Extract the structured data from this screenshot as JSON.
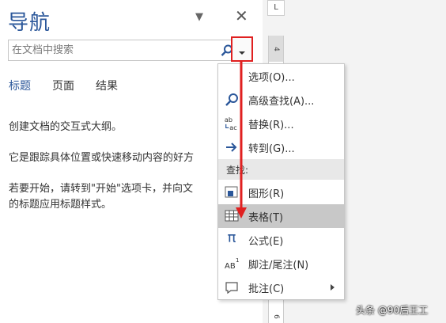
{
  "nav": {
    "title": "导航",
    "search_placeholder": "在文档中搜索",
    "tabs": [
      "标题",
      "页面",
      "结果"
    ],
    "description_lines": [
      "创建文档的交互式大纲。",
      "它是跟踪具体位置或快速移动内容的好方",
      "若要开始，请转到\"开始\"选项卡，并向文",
      "的标题应用标题样式。"
    ]
  },
  "ruler": {
    "top_letter": "L",
    "numbers": [
      "4",
      "6"
    ]
  },
  "menu": {
    "items": [
      {
        "label": "选项(O)...",
        "icon": "none"
      },
      {
        "label": "高级查找(A)...",
        "icon": "search-icon"
      },
      {
        "label": "替换(R)...",
        "icon": "replace-icon"
      },
      {
        "label": "转到(G)...",
        "icon": "arrow-right-icon"
      }
    ],
    "section_header": "查找:",
    "find_items": [
      {
        "label": "图形(R)",
        "icon": "graphic-icon"
      },
      {
        "label": "表格(T)",
        "icon": "table-icon",
        "highlighted": true
      },
      {
        "label": "公式(E)",
        "icon": "pi-icon"
      },
      {
        "label": "脚注/尾注(N)",
        "icon": "footnote-icon"
      },
      {
        "label": "批注(C)",
        "icon": "comment-icon",
        "has_submenu": true
      }
    ]
  },
  "watermark": "头条 @90后王工",
  "colors": {
    "accent": "#2b579a",
    "highlight_red": "#e02020",
    "selected_row": "#c8c8c8"
  }
}
